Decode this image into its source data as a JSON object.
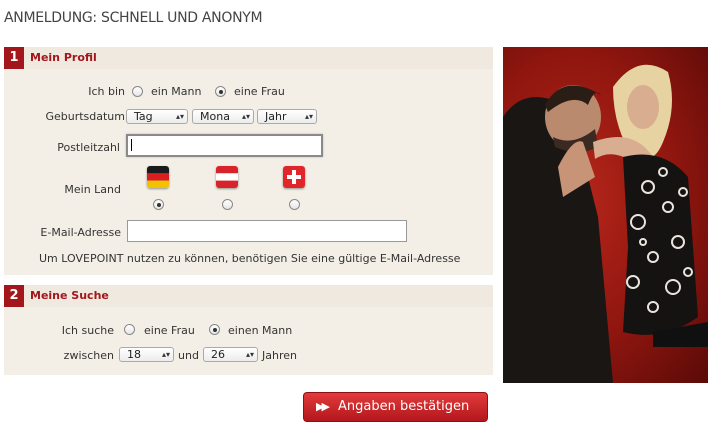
{
  "page_title": "ANMELDUNG: SCHNELL UND ANONYM",
  "profile": {
    "number": "1",
    "title": "Mein Profil",
    "gender_label": "Ich bin",
    "gender_options": [
      {
        "label": "ein Mann",
        "checked": false
      },
      {
        "label": "eine Frau",
        "checked": true
      }
    ],
    "birthdate_label": "Geburtsdatum",
    "birthdate_selects": {
      "day": "Tag",
      "month": "Mona",
      "year": "Jahr"
    },
    "zip_label": "Postleitzahl",
    "zip_value": "",
    "country_label": "Mein Land",
    "countries": [
      {
        "icon": "germany-flag-icon",
        "checked": true
      },
      {
        "icon": "austria-flag-icon",
        "checked": false
      },
      {
        "icon": "switzerland-flag-icon",
        "checked": false
      }
    ],
    "email_label": "E-Mail-Adresse",
    "email_value": "",
    "email_hint": "Um LOVEPOINT nutzen zu können, benötigen Sie eine gültige E-Mail-Adresse"
  },
  "search": {
    "number": "2",
    "title": "Meine Suche",
    "seeking_label": "Ich suche",
    "seeking_options": [
      {
        "label": "eine Frau",
        "checked": false
      },
      {
        "label": "einen Mann",
        "checked": true
      }
    ],
    "between_label": "zwischen",
    "age_from": "18",
    "and_label": "und",
    "age_to": "26",
    "years_label": "Jahren"
  },
  "submit_label": "Angaben bestätigen",
  "colors": {
    "accent": "#a3161c",
    "panel": "#f4efe6",
    "button": "#c8242a"
  }
}
